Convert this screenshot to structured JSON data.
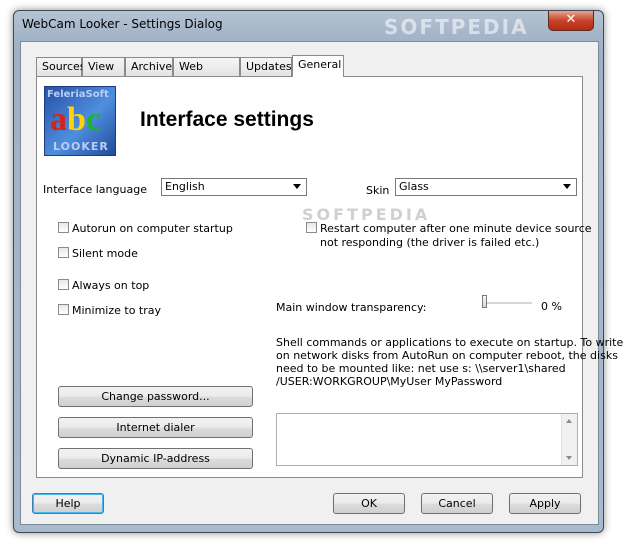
{
  "window": {
    "title": "WebCam Looker - Settings Dialog",
    "watermark": "SOFTPEDIA",
    "close": "✕"
  },
  "tabs": [
    "Sources",
    "View",
    "Archive",
    "Web server",
    "Updates",
    "General"
  ],
  "active_tab": "General",
  "logo": {
    "top_text": "FeleriaSoft",
    "a": "a",
    "b": "b",
    "c": "c",
    "bottom_text": "LOOKER"
  },
  "heading": "Interface settings",
  "interface_language": {
    "label": "Interface language",
    "value": "English"
  },
  "skin": {
    "label": "Skin",
    "value": "Glass"
  },
  "checkboxes": {
    "autorun": "Autorun on computer startup",
    "silent": "Silent mode",
    "always_on_top": "Always on top",
    "minimize_tray": "Minimize to tray",
    "restart_line1": "Restart computer after one minute device source",
    "restart_line2": "not responding (the driver is failed etc.)"
  },
  "transparency": {
    "label": "Main window transparency:",
    "value": "0 %",
    "level": 0
  },
  "shell_note": [
    "Shell commands or applications to execute on startup. To write",
    "on network disks from AutoRun on computer reboot, the disks",
    "need to be mounted like: net use s: \\\\server1\\shared",
    "/USER:WORKGROUP\\MyUser MyPassword"
  ],
  "buttons": {
    "change_password": "Change password...",
    "internet_dialer": "Internet dialer",
    "dynamic_ip": "Dynamic IP-address",
    "help": "Help",
    "ok": "OK",
    "cancel": "Cancel",
    "apply": "Apply"
  },
  "watermark_mid": "SOFTPEDIA"
}
